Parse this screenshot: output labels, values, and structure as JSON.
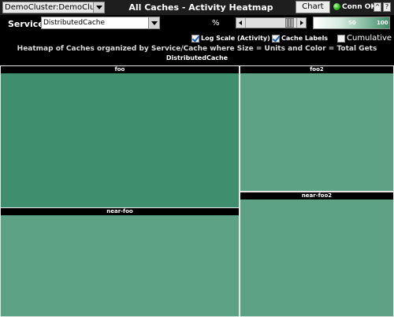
{
  "header": {
    "cluster_select": "DemoCluster:DemoCluster",
    "title": "All Caches - Activity Heatmap",
    "chart_button": "Chart",
    "connection_status": "Conn OK",
    "pin_button": "^",
    "help_button": "?"
  },
  "controls": {
    "service_label": "Service:",
    "service_select": "DistributedCache",
    "percent_label": "%",
    "legend_ticks": [
      "50",
      "100"
    ],
    "log_scale": {
      "label": "Log Scale (Activity)",
      "checked": true
    },
    "cache_labels": {
      "label": "Cache Labels",
      "checked": true
    },
    "cumulative": {
      "label": "Cumulative",
      "checked": false
    }
  },
  "subtitle": "Heatmap of Caches organized by Service/Cache where Size = Units and Color = Total Gets",
  "heatmap": {
    "group_label": "DistributedCache",
    "cells": [
      {
        "label": "foo",
        "color": "#3f8e6e"
      },
      {
        "label": "foo2",
        "color": "#5da285"
      },
      {
        "label": "near-foo",
        "color": "#5da285"
      },
      {
        "label": "near-foo2",
        "color": "#5da285"
      }
    ]
  }
}
